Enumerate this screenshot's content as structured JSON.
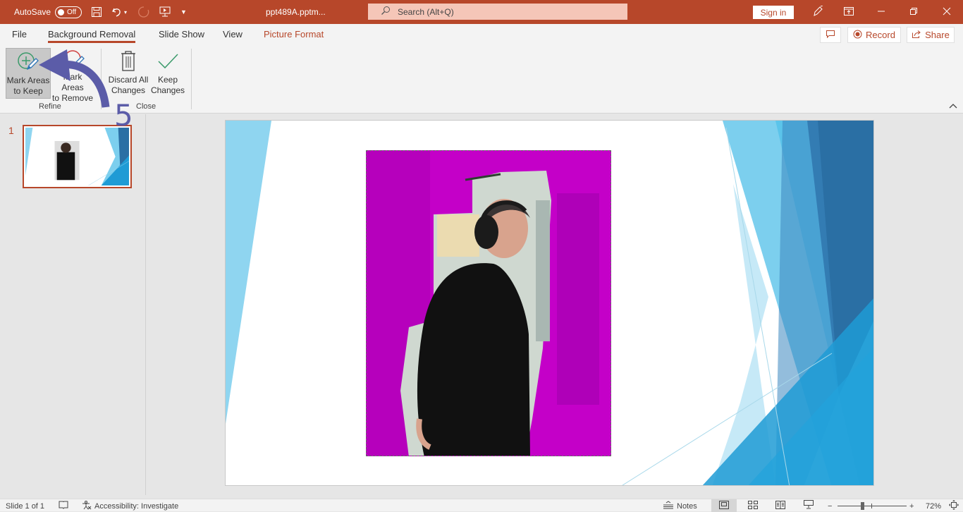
{
  "titlebar": {
    "autosave_label": "AutoSave",
    "autosave_state": "Off",
    "document_title": "ppt489A.pptm...",
    "search_placeholder": "Search (Alt+Q)",
    "sign_in_label": "Sign in",
    "icons": [
      "save-icon",
      "undo-icon",
      "undo-dropdown-icon",
      "redo-icon",
      "present-from-beginning-icon",
      "customize-qat-icon",
      "pen-icon",
      "ribbon-display-icon",
      "minimize-icon",
      "restore-icon",
      "close-icon"
    ]
  },
  "ribbon": {
    "tabs": [
      {
        "label": "File",
        "active": false,
        "contextual": false
      },
      {
        "label": "Background Removal",
        "active": true,
        "contextual": false
      },
      {
        "label": "Slide Show",
        "active": false,
        "contextual": false
      },
      {
        "label": "View",
        "active": false,
        "contextual": false
      },
      {
        "label": "Picture Format",
        "active": false,
        "contextual": true
      }
    ],
    "right_buttons": {
      "comments_icon": "comment-icon",
      "record_label": "Record",
      "share_label": "Share"
    },
    "groups": [
      {
        "label": "Refine",
        "buttons": [
          {
            "line1": "Mark Areas",
            "line2": "to Keep",
            "icon": "mark-keep-icon",
            "selected": true
          },
          {
            "line1": "Mark Areas",
            "line2": "to Remove",
            "icon": "mark-remove-icon",
            "selected": false
          }
        ]
      },
      {
        "label": "Close",
        "buttons": [
          {
            "line1": "Discard All",
            "line2": "Changes",
            "icon": "trash-icon",
            "selected": false
          },
          {
            "line1": "Keep",
            "line2": "Changes",
            "icon": "checkmark-icon",
            "selected": false
          }
        ]
      }
    ]
  },
  "annotation": {
    "step_number": "5",
    "color": "#5b5ca8"
  },
  "slides_pane": {
    "slides": [
      {
        "number": "1",
        "selected": true
      }
    ]
  },
  "slide": {
    "picture_overlay_color": "#c400c8",
    "theme_colors": [
      "#8fd5f0",
      "#5bc4ea",
      "#2a6fa4",
      "#1f9bd5",
      "#b8e4f5"
    ]
  },
  "statusbar": {
    "slide_info": "Slide 1 of 1",
    "accessibility": "Accessibility: Investigate",
    "notes_label": "Notes",
    "zoom_level": "72%",
    "zoom_fraction": 0.36,
    "views": [
      "normal-view",
      "slide-sorter-view",
      "reading-view",
      "slideshow-view"
    ]
  },
  "colors": {
    "brand": "#b7472a",
    "search_bg": "#f5c6b8",
    "ribbon_bg": "#f3f3f3"
  }
}
